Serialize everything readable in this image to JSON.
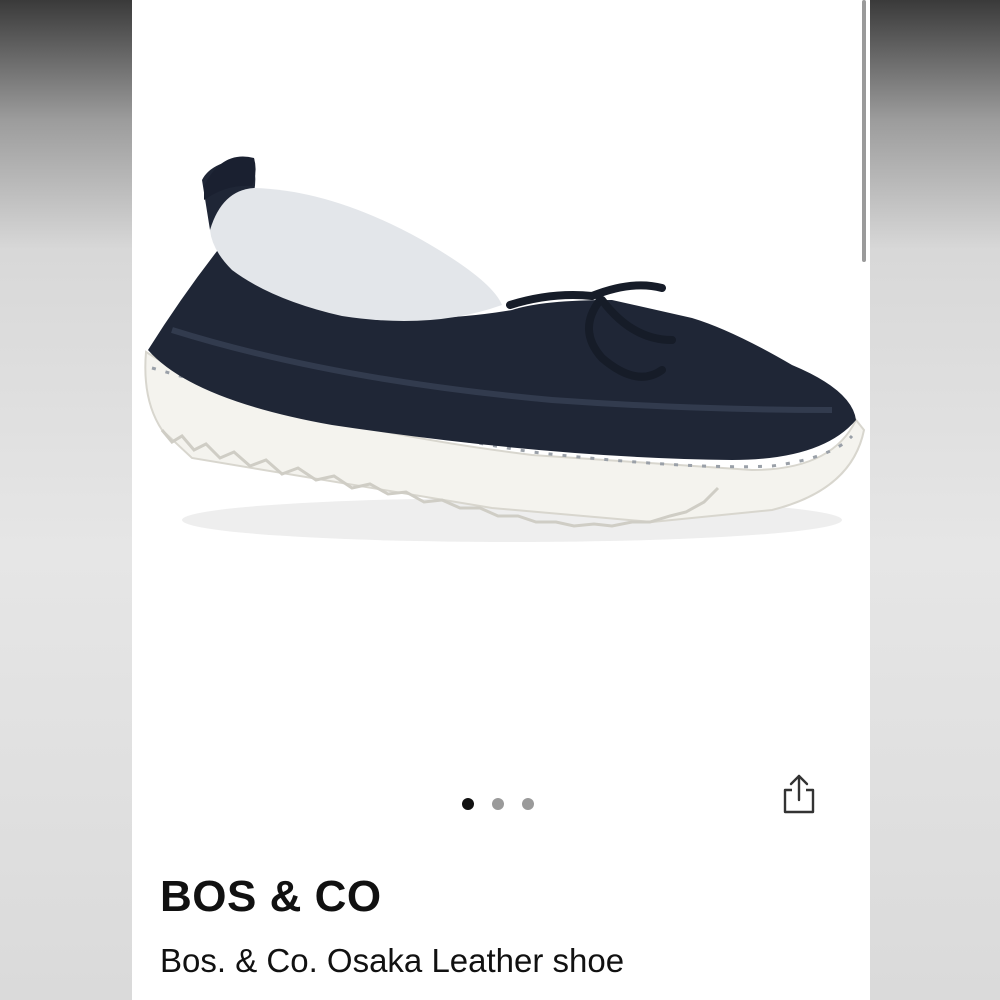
{
  "product": {
    "brand": "BOS & CO",
    "title": "Bos. & Co. Osaka Leather shoe"
  },
  "carousel": {
    "dot_count": 3,
    "active_index": 0
  },
  "icons": {
    "share": "share-icon"
  },
  "colors": {
    "shoe_leather": "#1f2636",
    "sole": "#f4f3ee",
    "active_dot": "#111111",
    "inactive_dot": "#9a9a9a"
  }
}
